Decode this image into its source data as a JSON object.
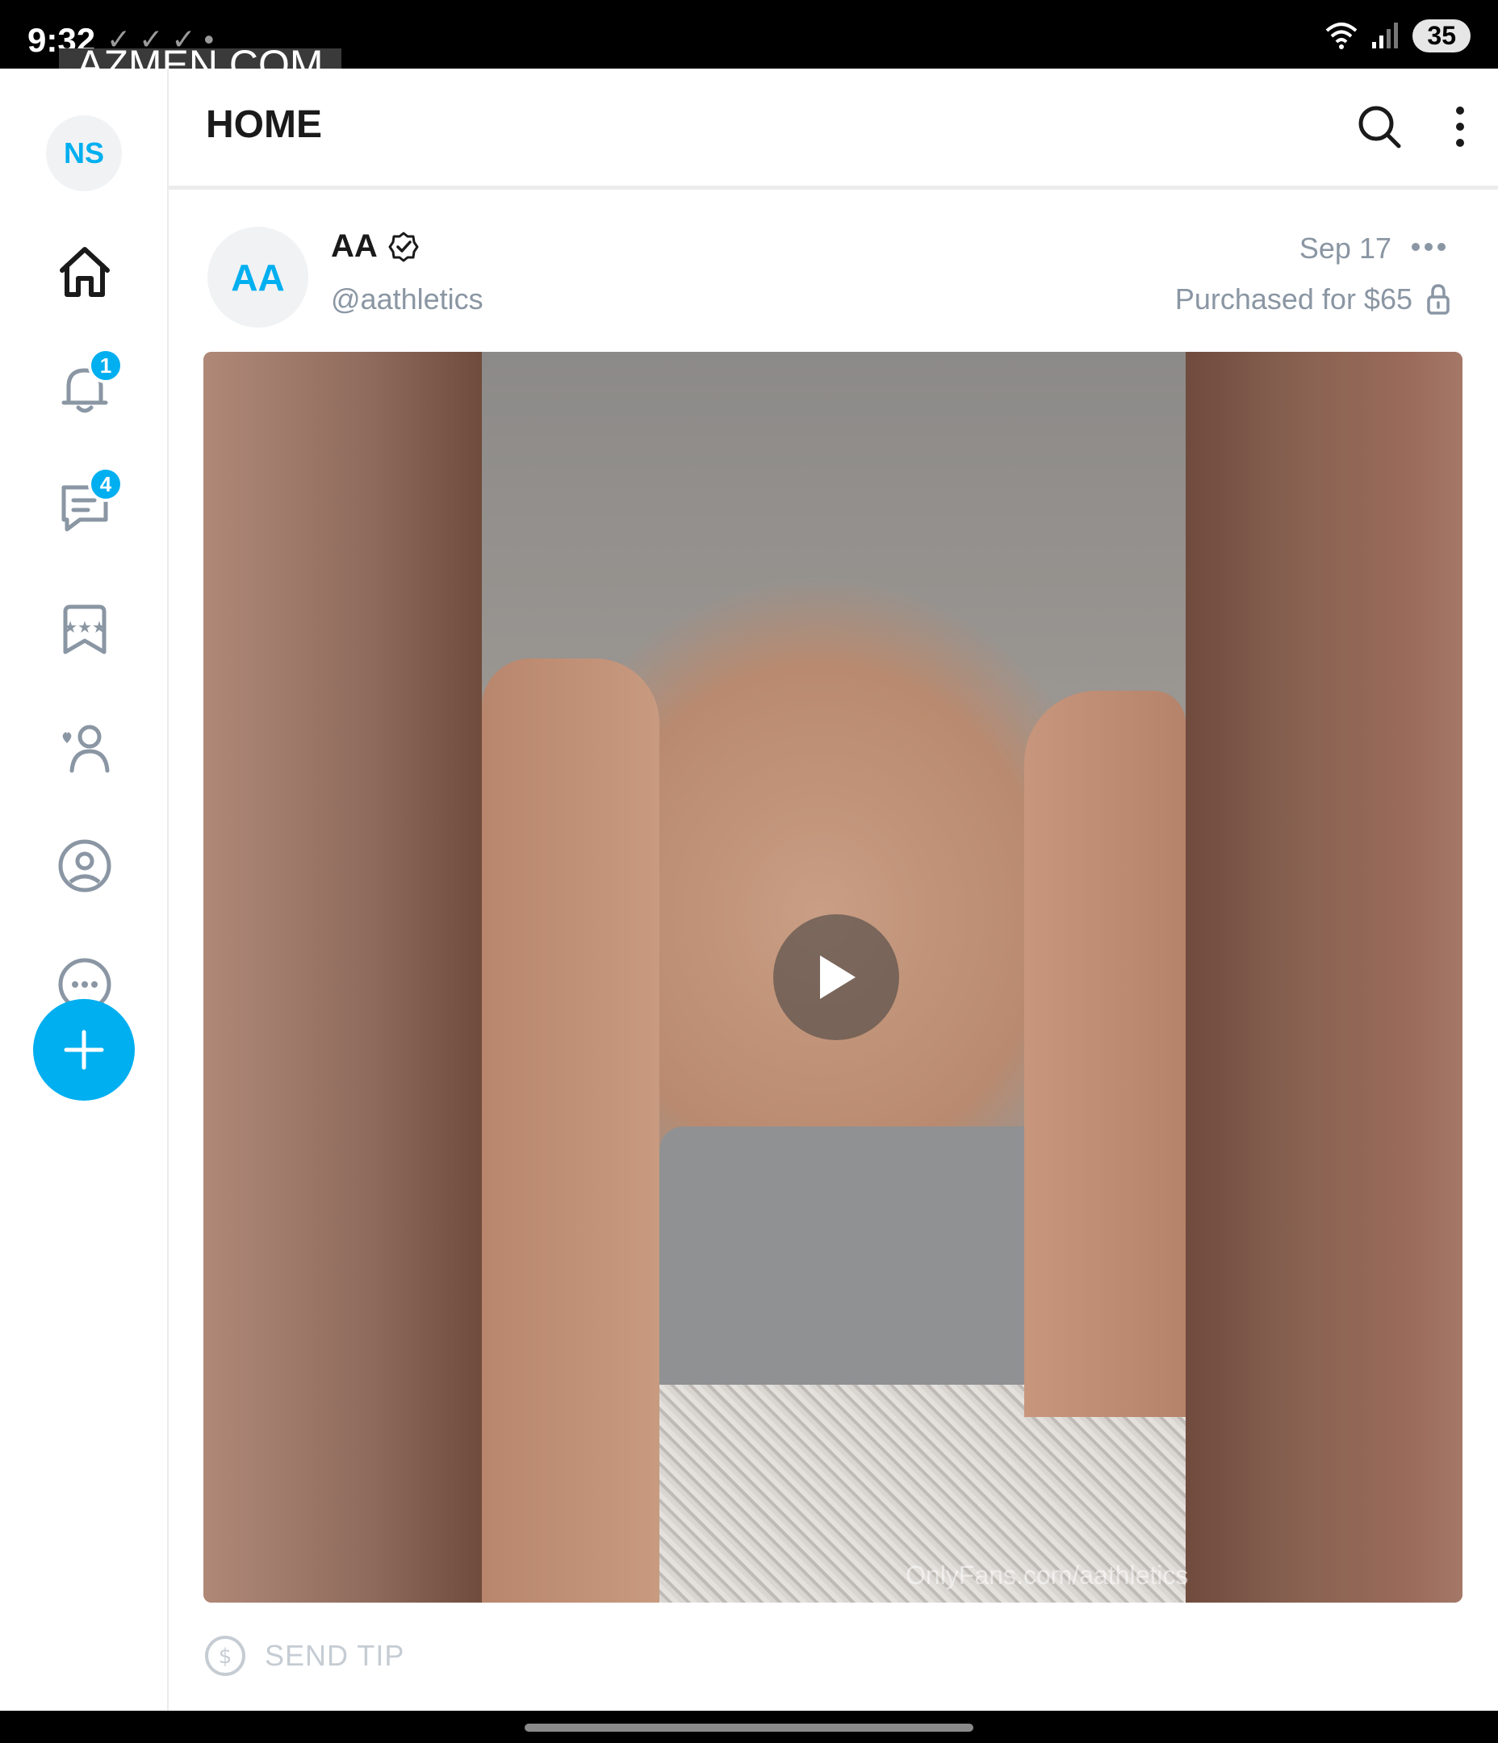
{
  "status_bar": {
    "time": "9:32",
    "checks": "✓✓✓•",
    "battery": "35"
  },
  "watermark": "AZMEN.COM",
  "sidebar": {
    "avatar_initials": "NS",
    "notifications_badge": "1",
    "messages_badge": "4"
  },
  "header": {
    "title": "HOME"
  },
  "post": {
    "avatar_initials": "AA",
    "author_name": "AA",
    "author_handle": "@aathletics",
    "date": "Sep 17",
    "purchase_text": "Purchased for $65",
    "media_credit": "OnlyFans.com/aathletics",
    "tip_label": "SEND TIP"
  },
  "colors": {
    "accent": "#00aff0",
    "muted_text": "#8a96a3",
    "disabled_text": "#c5ccd3"
  },
  "icons": [
    "home-icon",
    "bell-icon",
    "chat-icon",
    "collections-icon",
    "subscriptions-icon",
    "profile-icon",
    "more-circle-icon",
    "plus-icon",
    "search-icon",
    "kebab-icon",
    "verified-icon",
    "dots-icon",
    "lock-icon",
    "play-icon",
    "dollar-icon"
  ]
}
